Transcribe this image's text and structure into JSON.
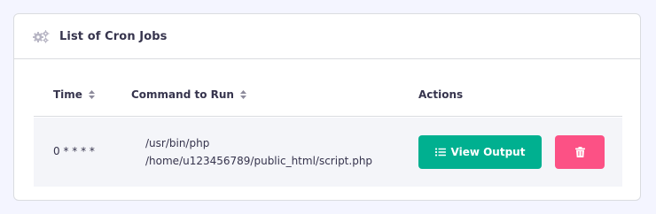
{
  "card": {
    "title": "List of Cron Jobs",
    "title_icon": "gears-icon"
  },
  "table": {
    "columns": [
      {
        "label": "Time",
        "sortable": true
      },
      {
        "label": "Command to Run",
        "sortable": true
      },
      {
        "label": "Actions",
        "sortable": false
      }
    ],
    "rows": [
      {
        "time": "0 * * * *",
        "command_line1": "/usr/bin/php",
        "command_line2": "/home/u123456789/public_html/script.php",
        "view_output_label": "View Output",
        "view_output_icon": "list-icon",
        "delete_icon": "trash-icon"
      }
    ]
  },
  "colors": {
    "background": "#f4f5ff",
    "primary_button": "#00b090",
    "danger_button": "#fc5185",
    "row_background": "#f4f5f9",
    "text": "#36344d"
  }
}
